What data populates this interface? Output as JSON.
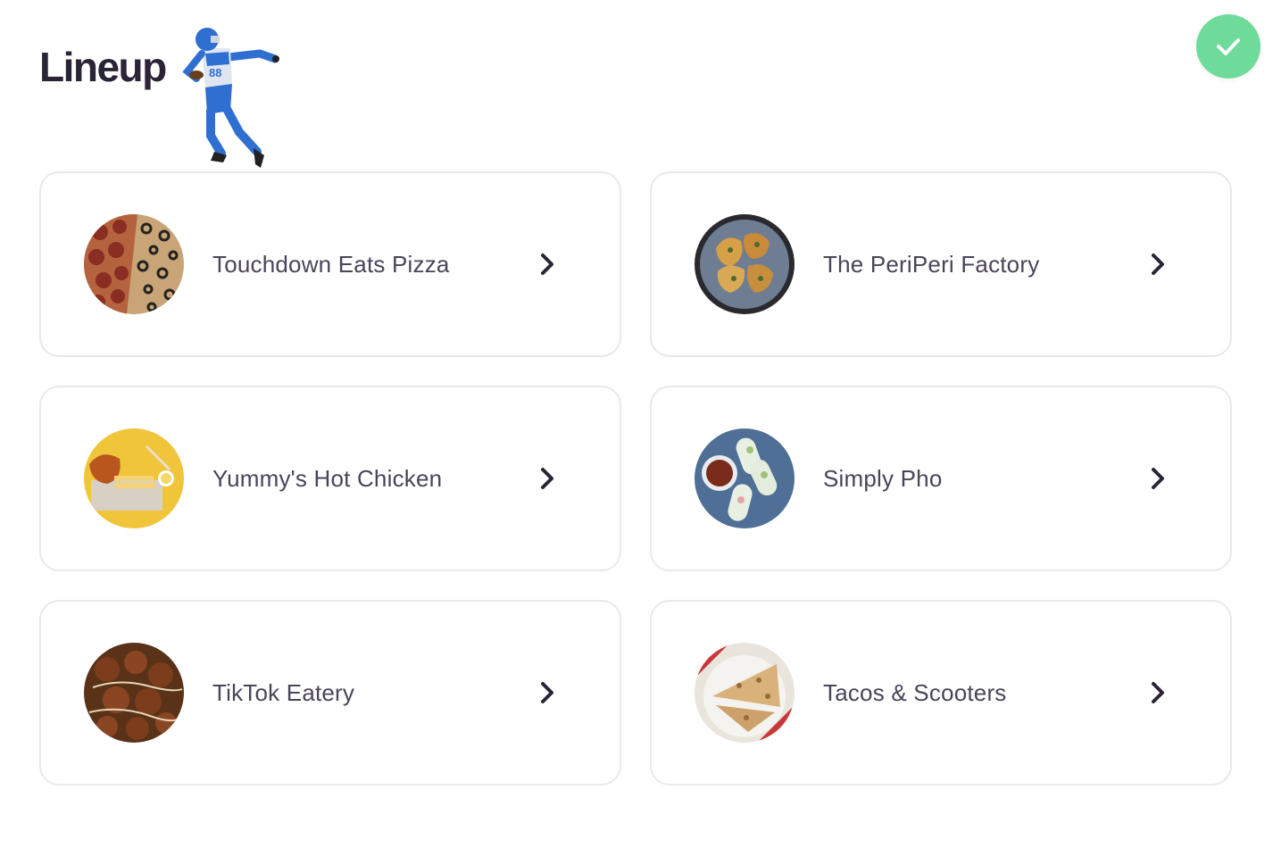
{
  "header": {
    "title": "Lineup",
    "mascot_icon": "football-player-image",
    "confirm_icon": "check-icon",
    "confirm_color": "#6fdb9b"
  },
  "vendors": [
    {
      "name": "Touchdown Eats Pizza",
      "image": "pizza-image"
    },
    {
      "name": "The PeriPeri Factory",
      "image": "peri-peri-chicken-image"
    },
    {
      "name": "Yummy's Hot Chicken",
      "image": "hot-chicken-image"
    },
    {
      "name": "Simply Pho",
      "image": "spring-rolls-image"
    },
    {
      "name": "TikTok Eatery",
      "image": "meatballs-image"
    },
    {
      "name": "Tacos & Scooters",
      "image": "quesadilla-image"
    }
  ],
  "colors": {
    "title": "#2b2437",
    "text": "#4a4458",
    "card_border": "#e9e9ee",
    "chevron": "#2b2437"
  }
}
